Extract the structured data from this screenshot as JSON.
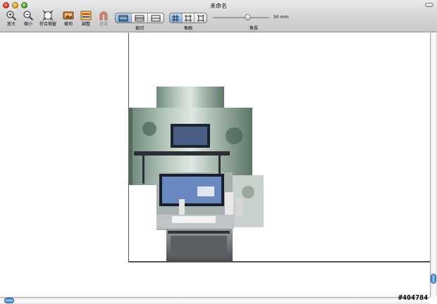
{
  "window": {
    "title": "未命名"
  },
  "toolbar": {
    "tools": [
      {
        "label": "放大",
        "icon": "zoom-in-icon"
      },
      {
        "label": "縮小",
        "icon": "zoom-out-icon"
      },
      {
        "label": "符合視窗",
        "icon": "fit-window-icon"
      },
      {
        "label": "幾何",
        "icon": "geometry-icon"
      },
      {
        "label": "調整",
        "icon": "adjust-icon"
      },
      {
        "label": "遮罩",
        "icon": "mask-icon"
      }
    ],
    "crop_label": "裁切",
    "fisheye_label": "魚眼",
    "focal_label": "焦長",
    "focal_value": "50 mm",
    "focal_fraction": 0.62
  },
  "colors": {
    "accent": "#7fa9d9",
    "scroll": "#3f7fc8"
  },
  "watermark": "#404784"
}
